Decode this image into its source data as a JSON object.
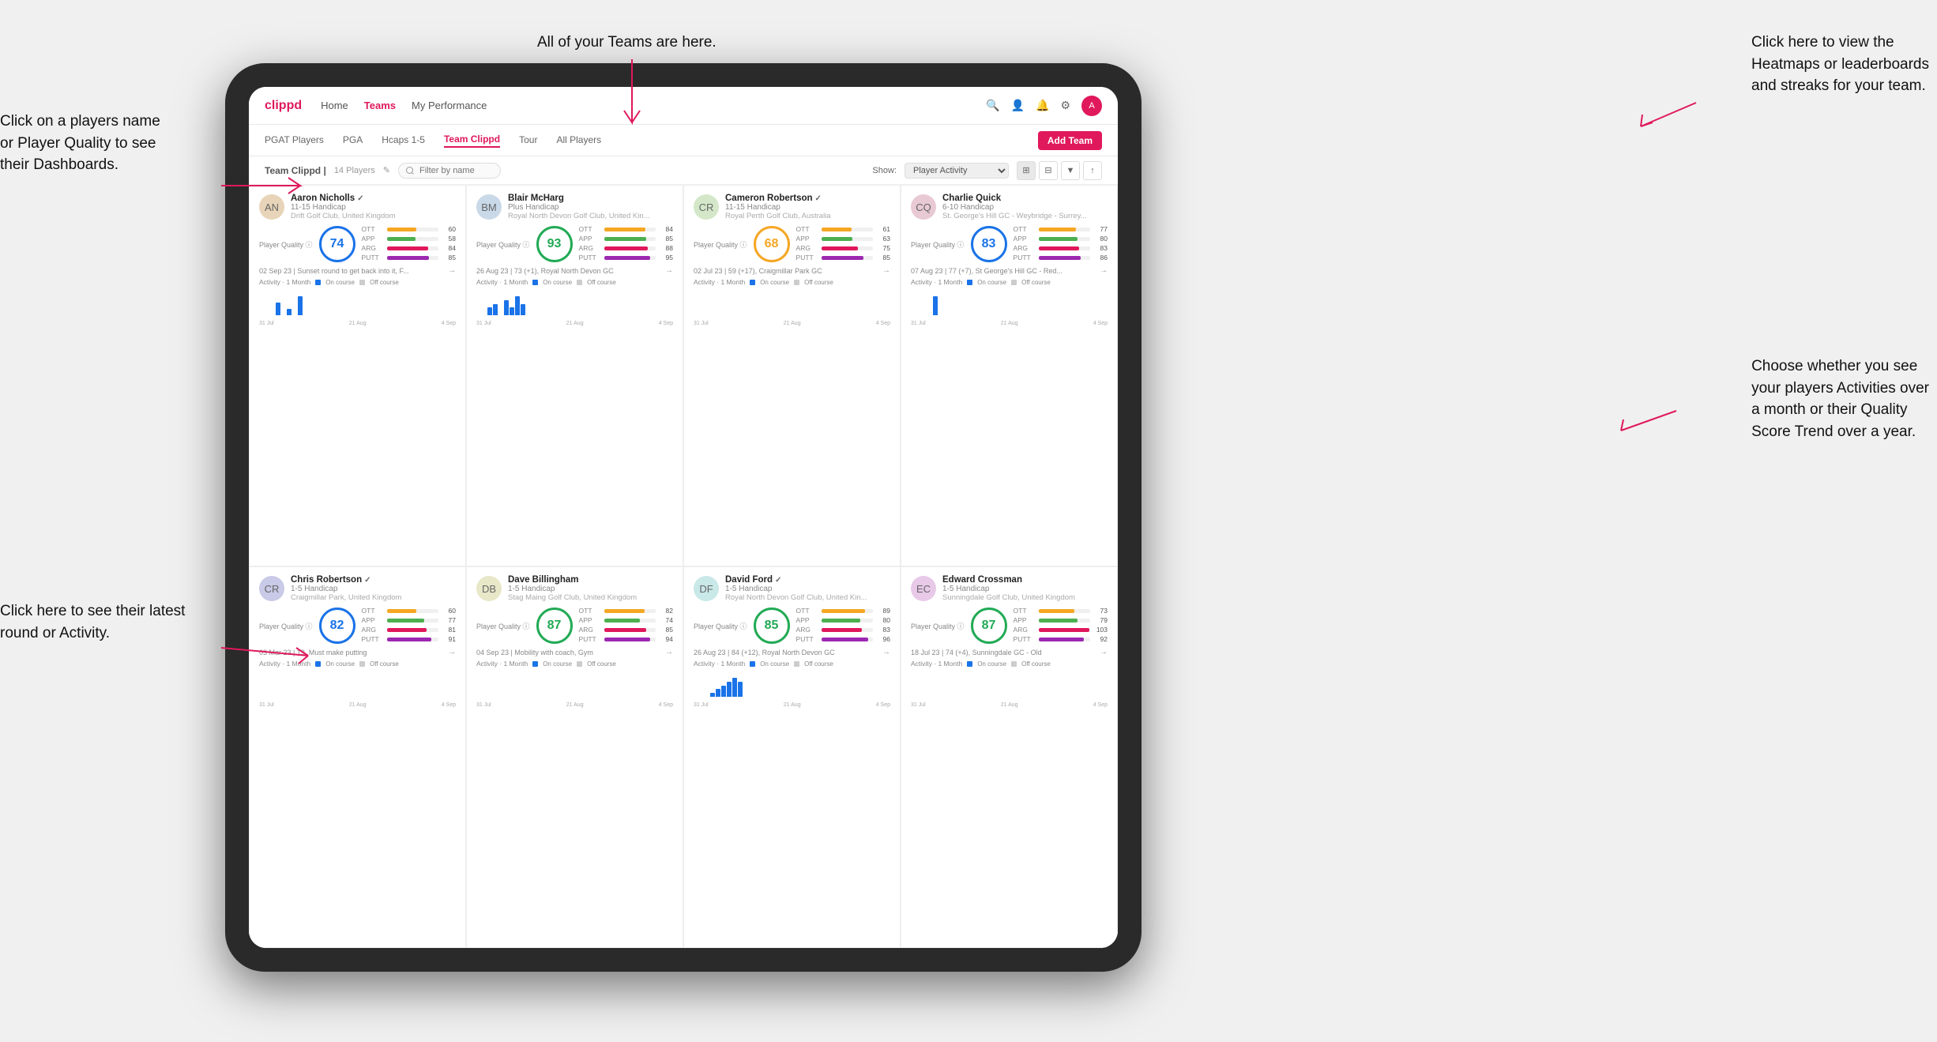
{
  "annotations": {
    "teams_tooltip": "All of your Teams are here.",
    "heatmaps_tooltip": "Click here to view the\nHeatmaps or leaderboards\nand streaks for your team.",
    "player_name_tooltip": "Click on a players name\nor Player Quality to see\ntheir Dashboards.",
    "round_tooltip": "Click here to see their latest\nround or Activity.",
    "activity_tooltip": "Choose whether you see\nyour players Activities over\na month or their Quality\nScore Trend over a year."
  },
  "nav": {
    "logo": "clippd",
    "items": [
      "Home",
      "Teams",
      "My Performance"
    ],
    "active": "Teams"
  },
  "sub_nav": {
    "items": [
      "PGAT Players",
      "PGA",
      "Hcaps 1-5",
      "Team Clippd",
      "Tour",
      "All Players"
    ],
    "active": "Team Clippd",
    "add_team_label": "Add Team"
  },
  "team_header": {
    "name": "Team Clippd",
    "count": "14 Players",
    "show_label": "Show:",
    "show_value": "Player Activity",
    "filter_placeholder": "Filter by name"
  },
  "players": [
    {
      "name": "Aaron Nicholls",
      "handicap": "11-15 Handicap",
      "club": "Drift Golf Club, United Kingdom",
      "quality": 74,
      "quality_color": "blue",
      "ott": 60,
      "app": 58,
      "arg": 84,
      "putt": 85,
      "latest_round": "02 Sep 23 | Sunset round to get back into it, F...",
      "bars": [
        0,
        0,
        0,
        2,
        0,
        1,
        0,
        3,
        0
      ]
    },
    {
      "name": "Blair McHarg",
      "handicap": "Plus Handicap",
      "club": "Royal North Devon Golf Club, United Kin...",
      "quality": 93,
      "quality_color": "green",
      "ott": 84,
      "app": 85,
      "arg": 88,
      "putt": 95,
      "latest_round": "26 Aug 23 | 73 (+1), Royal North Devon GC",
      "bars": [
        0,
        0,
        2,
        3,
        0,
        4,
        2,
        5,
        3
      ]
    },
    {
      "name": "Cameron Robertson",
      "handicap": "11-15 Handicap",
      "club": "Royal Perth Golf Club, Australia",
      "quality": 68,
      "quality_color": "orange",
      "ott": 61,
      "app": 63,
      "arg": 75,
      "putt": 85,
      "latest_round": "02 Jul 23 | 59 (+17), Craigmillar Park GC",
      "bars": [
        0,
        0,
        0,
        0,
        0,
        0,
        0,
        0,
        0
      ]
    },
    {
      "name": "Charlie Quick",
      "handicap": "6-10 Handicap",
      "club": "St. George's Hill GC - Weybridge - Surrey...",
      "quality": 83,
      "quality_color": "blue",
      "ott": 77,
      "app": 80,
      "arg": 83,
      "putt": 86,
      "latest_round": "07 Aug 23 | 77 (+7), St George's Hill GC - Red...",
      "bars": [
        0,
        0,
        0,
        0,
        2,
        0,
        0,
        0,
        0
      ]
    },
    {
      "name": "Chris Robertson",
      "handicap": "1-5 Handicap",
      "club": "Craigmillar Park, United Kingdom",
      "quality": 82,
      "quality_color": "blue",
      "ott": 60,
      "app": 77,
      "arg": 81,
      "putt": 91,
      "latest_round": "03 Mar 23 | 19, Must make putting",
      "bars": [
        0,
        0,
        0,
        0,
        0,
        0,
        0,
        0,
        0
      ]
    },
    {
      "name": "Dave Billingham",
      "handicap": "1-5 Handicap",
      "club": "Stag Maing Golf Club, United Kingdom",
      "quality": 87,
      "quality_color": "green",
      "ott": 82,
      "app": 74,
      "arg": 85,
      "putt": 94,
      "latest_round": "04 Sep 23 | Mobility with coach, Gym",
      "bars": [
        0,
        0,
        0,
        0,
        0,
        0,
        0,
        0,
        0
      ]
    },
    {
      "name": "David Ford",
      "handicap": "1-5 Handicap",
      "club": "Royal North Devon Golf Club, United Kin...",
      "quality": 85,
      "quality_color": "green",
      "ott": 89,
      "app": 80,
      "arg": 83,
      "putt": 96,
      "latest_round": "26 Aug 23 | 84 (+12), Royal North Devon GC",
      "bars": [
        0,
        0,
        0,
        1,
        2,
        3,
        4,
        5,
        4
      ]
    },
    {
      "name": "Edward Crossman",
      "handicap": "1-5 Handicap",
      "club": "Sunningdale Golf Club, United Kingdom",
      "quality": 87,
      "quality_color": "green",
      "ott": 73,
      "app": 79,
      "arg": 103,
      "putt": 92,
      "latest_round": "18 Jul 23 | 74 (+4), Sunningdale GC - Old",
      "bars": [
        0,
        0,
        0,
        0,
        0,
        0,
        0,
        0,
        0
      ]
    }
  ],
  "view_icons": [
    "⊞",
    "⊟",
    "▼",
    "↑"
  ],
  "chart_labels": [
    "31 Jul",
    "21 Aug",
    "4 Sep"
  ]
}
